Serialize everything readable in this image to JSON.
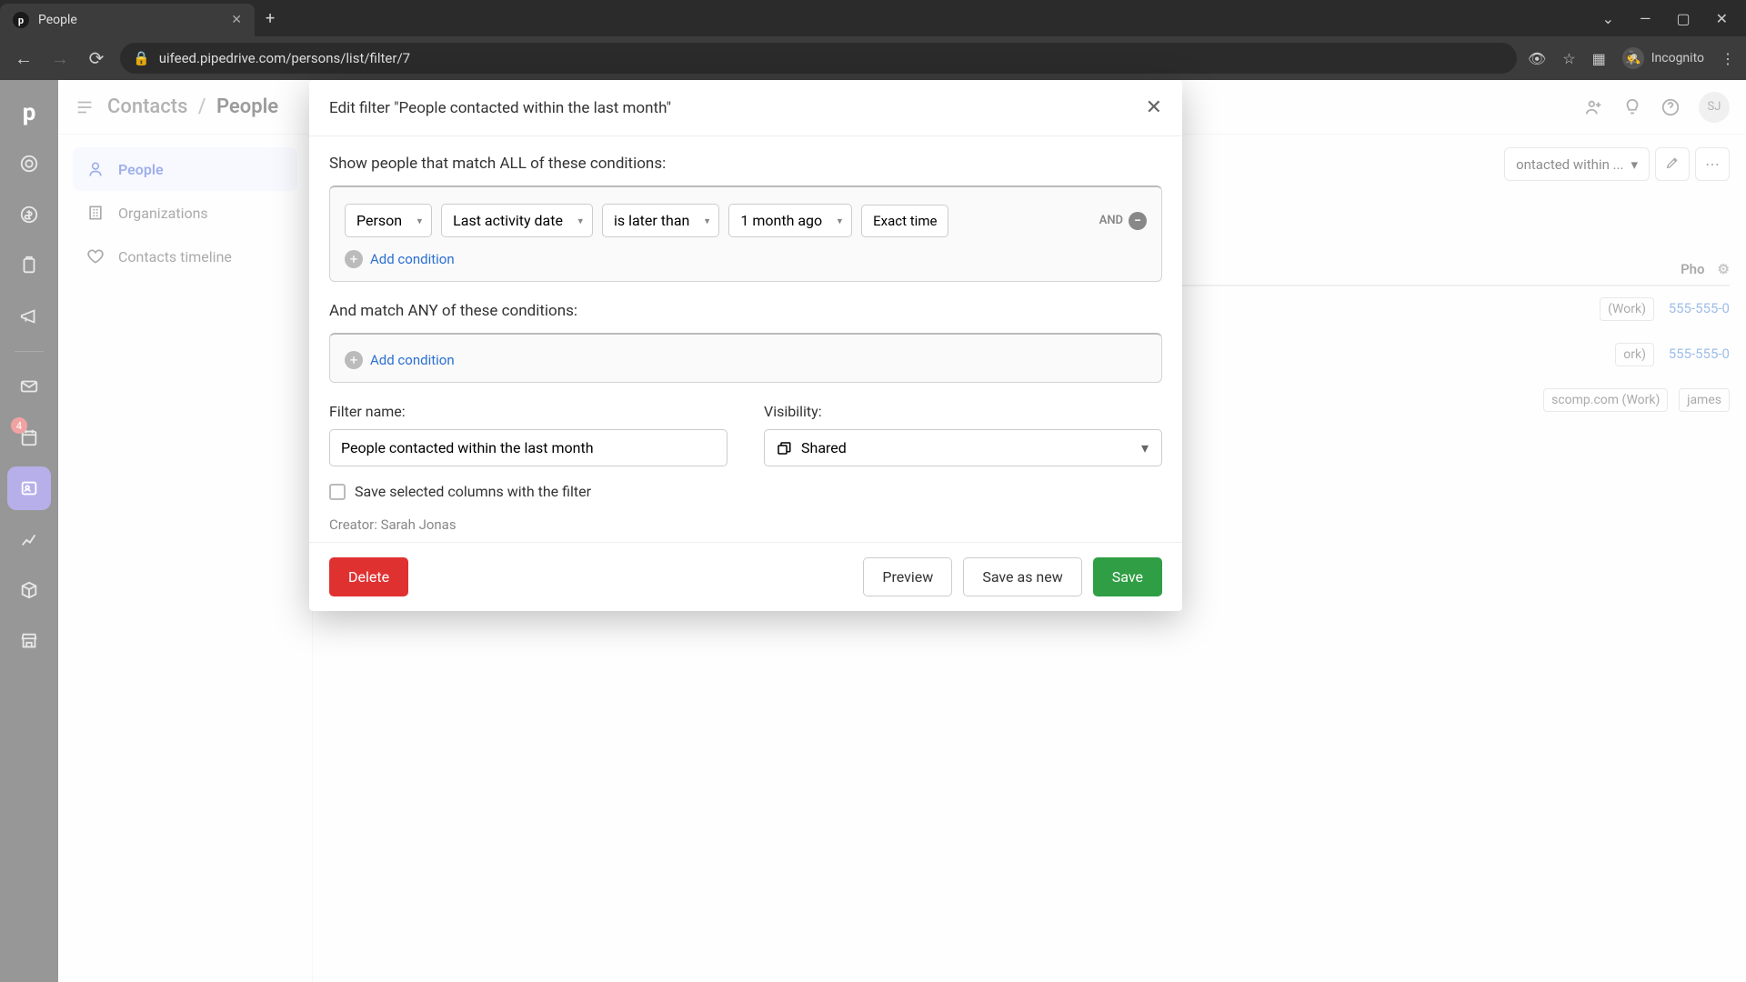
{
  "browser": {
    "tab_title": "People",
    "tab_favicon": "p",
    "url": "uifeed.pipedrive.com/persons/list/filter/7",
    "incognito_label": "Incognito"
  },
  "left_rail": {
    "logo": "p",
    "badge_count": "4"
  },
  "topbar": {
    "crumb_root": "Contacts",
    "crumb_current": "People",
    "avatar_initials": "SJ"
  },
  "side_nav": {
    "items": [
      {
        "label": "People",
        "active": true
      },
      {
        "label": "Organizations",
        "active": false
      },
      {
        "label": "Contacts timeline",
        "active": false
      }
    ]
  },
  "filter_bar": {
    "dropdown_label": "ontacted within ..."
  },
  "table_peek": {
    "col_phone": "Pho",
    "rows": [
      {
        "chip": "(Work)",
        "phone": "555-555-0"
      },
      {
        "chip": "ork)",
        "phone": "555-555-0"
      },
      {
        "chip": "scomp.com (Work)",
        "phone": "james"
      }
    ]
  },
  "modal": {
    "title": "Edit filter \"People contacted within the last month\"",
    "all_label": "Show people that match ALL of these conditions:",
    "condition": {
      "entity": "Person",
      "field": "Last activity date",
      "operator": "is later than",
      "value": "1 month ago",
      "exact_time": "Exact time",
      "and_label": "AND"
    },
    "add_condition": "Add condition",
    "any_label": "And match ANY of these conditions:",
    "filter_name_label": "Filter name:",
    "filter_name_value": "People contacted within the last month",
    "visibility_label": "Visibility:",
    "visibility_value": "Shared",
    "save_columns_label": "Save selected columns with the filter",
    "creator_label": "Creator: Sarah Jonas",
    "buttons": {
      "delete": "Delete",
      "preview": "Preview",
      "save_as_new": "Save as new",
      "save": "Save"
    }
  }
}
